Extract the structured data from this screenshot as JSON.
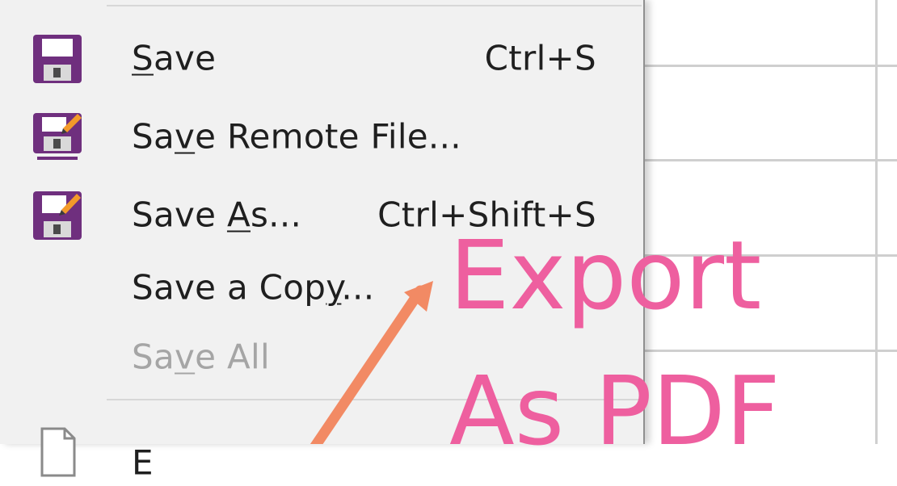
{
  "menu": {
    "items": [
      {
        "label_pre": "",
        "label_u": "S",
        "label_post": "ave",
        "shortcut": "Ctrl+S",
        "icon": "floppy-disk-icon",
        "disabled": false
      },
      {
        "label_pre": "Sa",
        "label_u": "v",
        "label_post": "e Remote File...",
        "shortcut": "",
        "icon": "save-remote-file-icon",
        "disabled": false
      },
      {
        "label_pre": "Save ",
        "label_u": "A",
        "label_post": "s...",
        "shortcut": "Ctrl+Shift+S",
        "icon": "save-as-icon",
        "disabled": false
      },
      {
        "label_pre": "Save a Cop",
        "label_u": "y",
        "label_post": "...",
        "shortcut": "",
        "icon": "",
        "disabled": false
      },
      {
        "label_pre": "Sa",
        "label_u": "v",
        "label_post": "e All",
        "shortcut": "",
        "icon": "",
        "disabled": true
      },
      {
        "label_pre": "E",
        "label_u": "",
        "label_post": "",
        "shortcut": "",
        "icon": "document-icon",
        "disabled": false
      }
    ]
  },
  "annotation": {
    "line1": "Export",
    "line2": "As PDF",
    "color": "#ee5f9f",
    "arrow_color": "#f28a64"
  }
}
